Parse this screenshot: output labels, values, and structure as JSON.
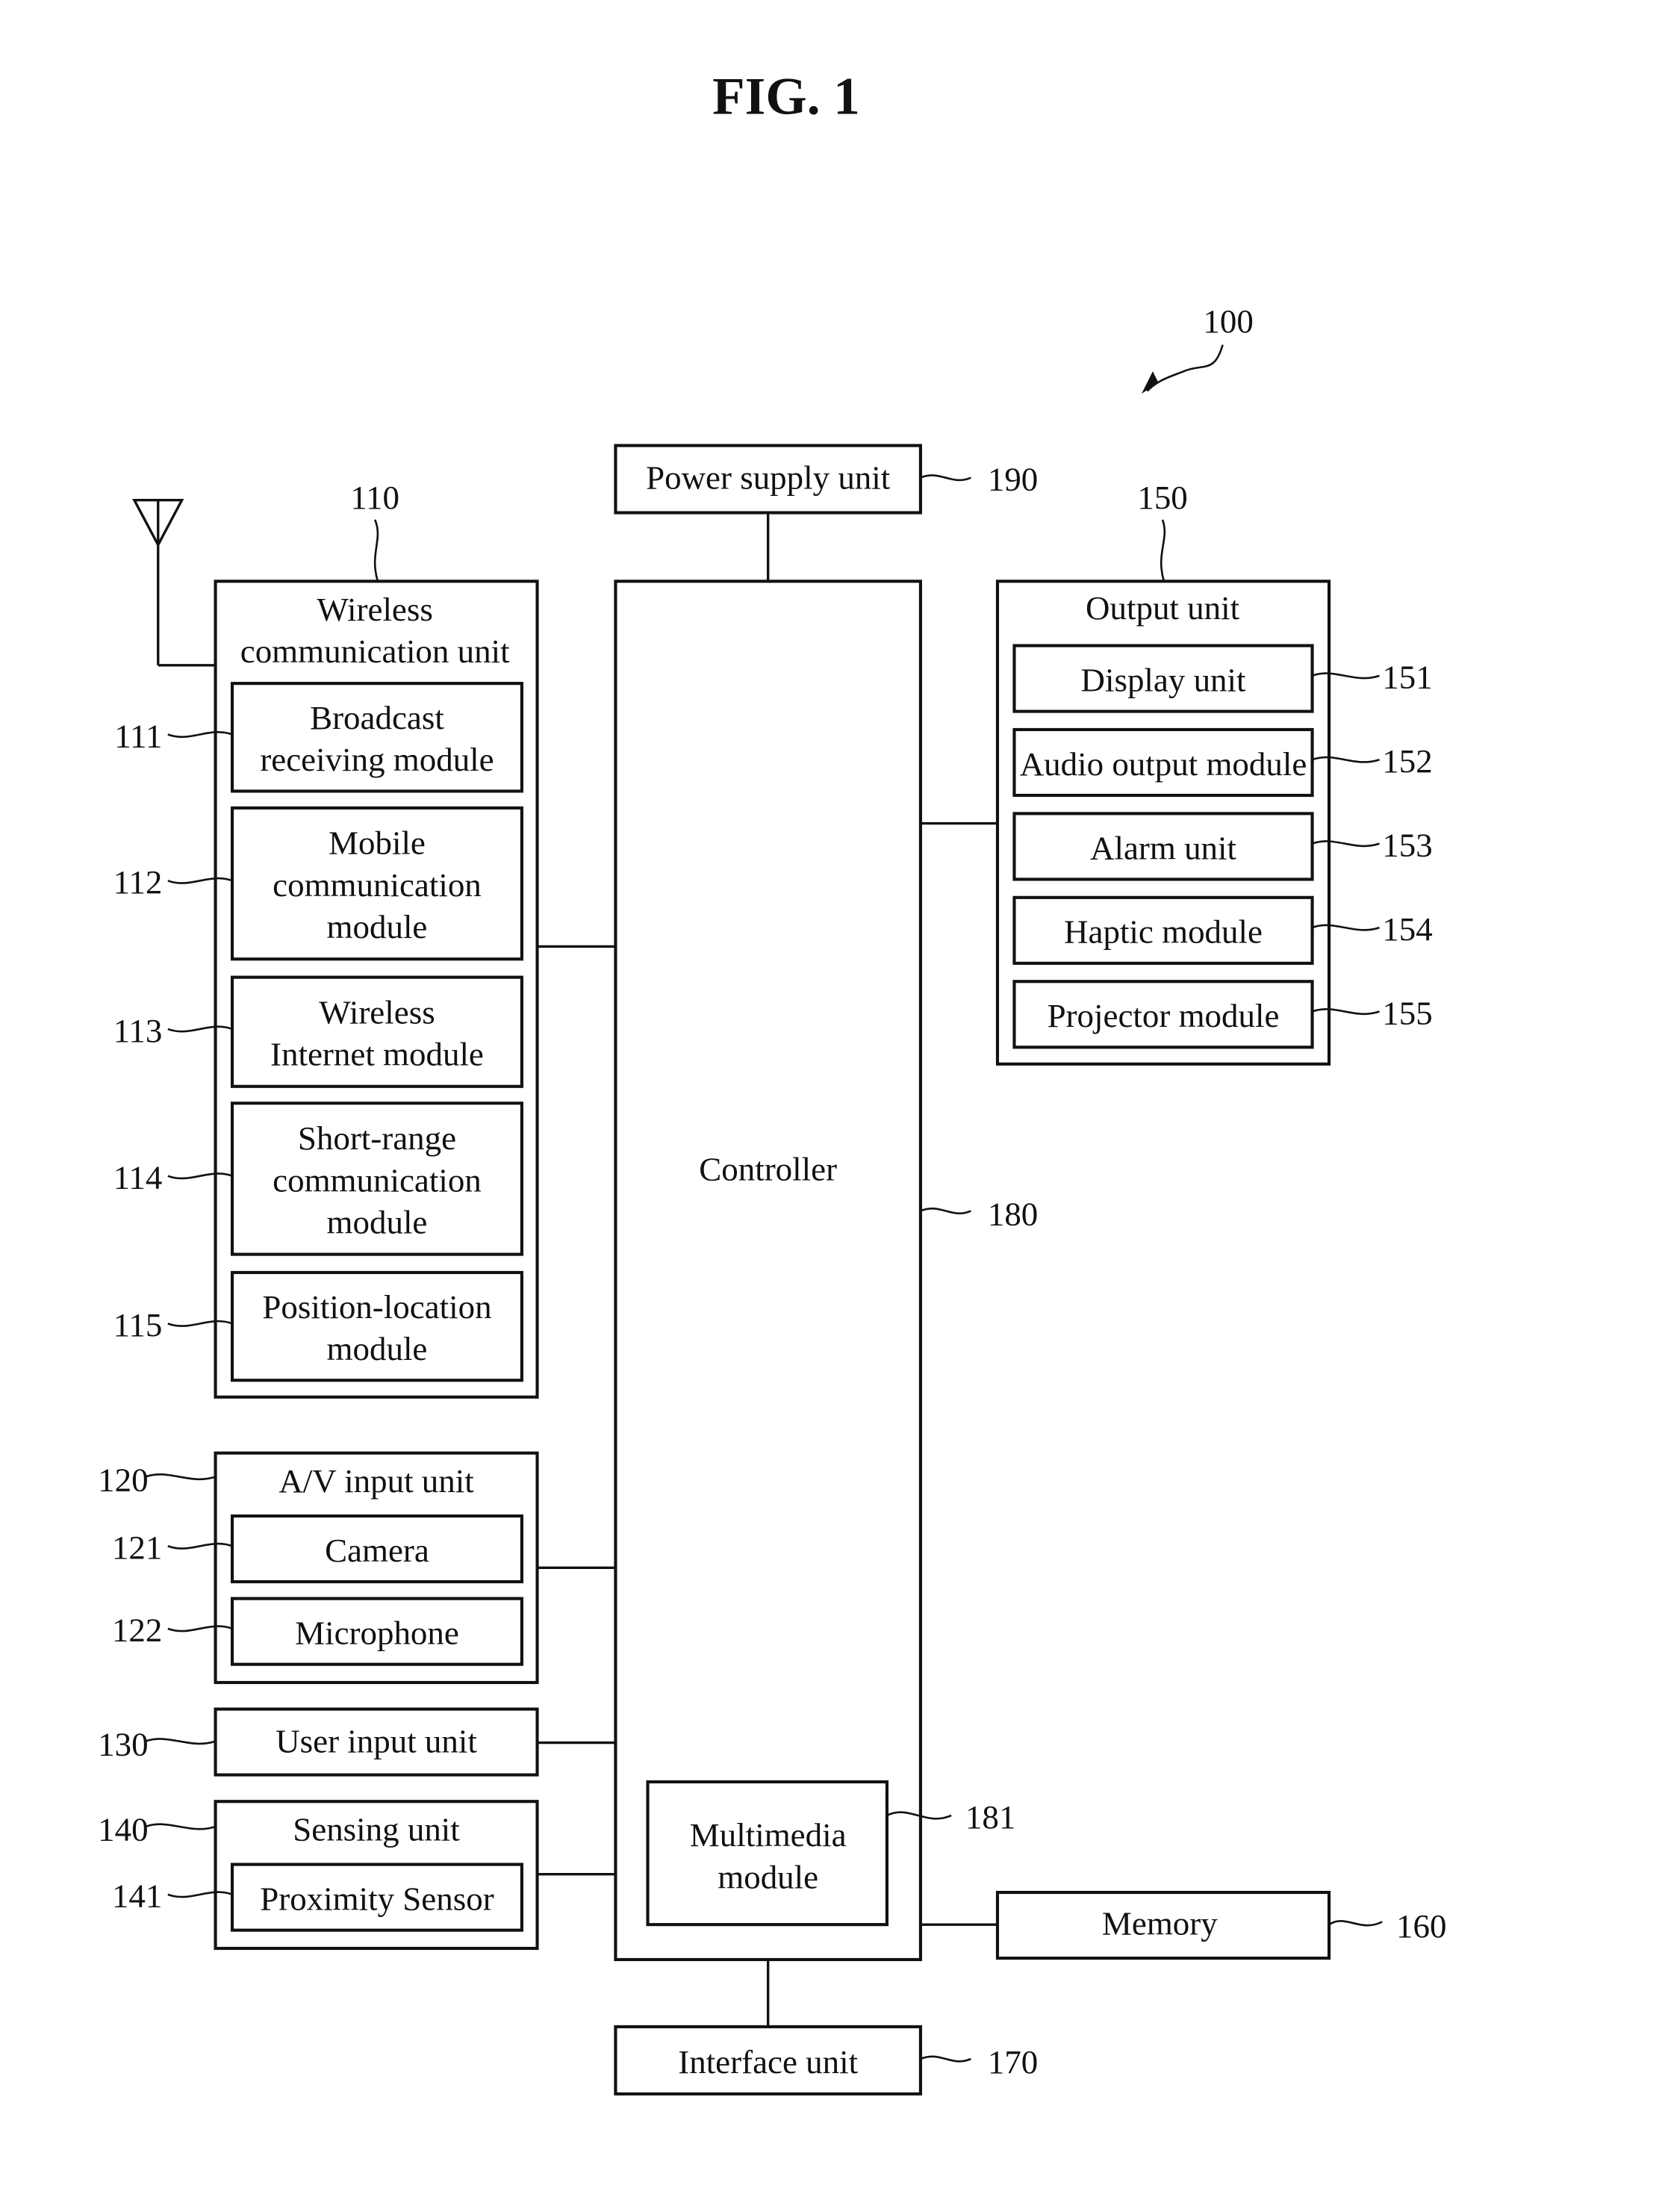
{
  "figure": {
    "title": "FIG. 1",
    "device_ref": "100"
  },
  "power_supply": {
    "label": "Power supply unit",
    "ref": "190"
  },
  "controller": {
    "label": "Controller",
    "ref": "180"
  },
  "multimedia": {
    "label_lines": [
      "Multimedia",
      "module"
    ],
    "ref": "181"
  },
  "memory": {
    "label": "Memory",
    "ref": "160"
  },
  "interface": {
    "label": "Interface unit",
    "ref": "170"
  },
  "wireless": {
    "title_lines": [
      "Wireless",
      "communication unit"
    ],
    "ref": "110",
    "modules": [
      {
        "lines": [
          "Broadcast",
          "receiving module"
        ],
        "ref": "111"
      },
      {
        "lines": [
          "Mobile",
          "communication",
          "module"
        ],
        "ref": "112"
      },
      {
        "lines": [
          "Wireless",
          "Internet module"
        ],
        "ref": "113"
      },
      {
        "lines": [
          "Short-range",
          "communication",
          "module"
        ],
        "ref": "114"
      },
      {
        "lines": [
          "Position-location",
          "module"
        ],
        "ref": "115"
      }
    ]
  },
  "av_input": {
    "title": "A/V input unit",
    "ref": "120",
    "modules": [
      {
        "label": "Camera",
        "ref": "121"
      },
      {
        "label": "Microphone",
        "ref": "122"
      }
    ]
  },
  "user_input": {
    "label": "User input unit",
    "ref": "130"
  },
  "sensing": {
    "title": "Sensing unit",
    "ref": "140",
    "modules": [
      {
        "label": "Proximity Sensor",
        "ref": "141"
      }
    ]
  },
  "output": {
    "title": "Output unit",
    "ref": "150",
    "modules": [
      {
        "label": "Display unit",
        "ref": "151"
      },
      {
        "label": "Audio output module",
        "ref": "152"
      },
      {
        "label": "Alarm unit",
        "ref": "153"
      },
      {
        "label": "Haptic module",
        "ref": "154"
      },
      {
        "label": "Projector module",
        "ref": "155"
      }
    ]
  }
}
